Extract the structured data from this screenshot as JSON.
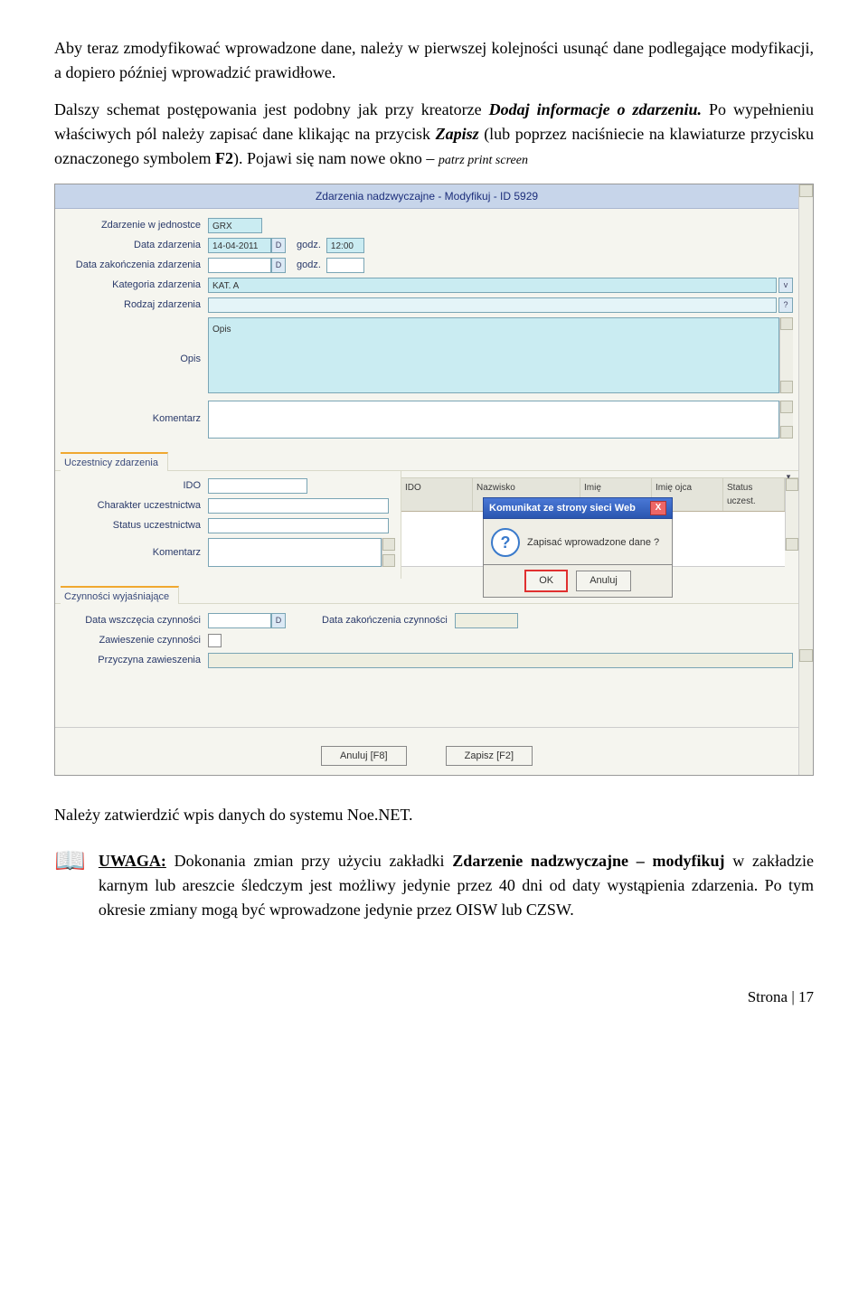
{
  "paragraph1": {
    "plain1": "Aby teraz zmodyfikować wprowadzone dane, należy w pierwszej kolejności usunąć dane podlegające modyfikacji, a dopiero później wprowadzić prawidłowe."
  },
  "paragraph2": {
    "lead": "Dalszy schemat postępowania jest podobny jak przy kreatorze ",
    "em1": "Dodaj informacje o zdarzeniu.",
    "cont1": " Po wypełnieniu właściwych pól należy zapisać dane klikając na przycisk ",
    "em2": "Zapisz",
    "cont2": " (lub poprzez naciśniecie na klawiaturze przycisku oznaczonego symbolem ",
    "f2": "F2",
    "cont3": "). Pojawi się nam nowe okno – ",
    "em3": "patrz print screen"
  },
  "screenshot": {
    "title": "Zdarzenia nadzwyczajne - Modyfikuj - ID 5929",
    "labels": {
      "jednostka": "Zdarzenie w jednostce",
      "data_zd": "Data zdarzenia",
      "godz": "godz.",
      "data_zak_zd": "Data zakończenia zdarzenia",
      "kategoria": "Kategoria zdarzenia",
      "rodzaj": "Rodzaj zdarzenia",
      "opis": "Opis",
      "komentarz": "Komentarz",
      "uczestnicy": "Uczestnicy zdarzenia",
      "ido": "IDO",
      "charakter": "Charakter uczestnictwa",
      "status_u": "Status uczestnictwa",
      "koment2": "Komentarz",
      "czynnosci": "Czynności wyjaśniające",
      "data_wszczecia": "Data wszczęcia czynności",
      "data_zak_czyn": "Data zakończenia czynności",
      "zawieszenie": "Zawieszenie czynności",
      "przyczyna": "Przyczyna zawieszenia"
    },
    "values": {
      "grx": "GRX",
      "data_zd": "14-04-2011",
      "godz": "12:00",
      "opis_content": "Opis",
      "kat": "KAT. A"
    },
    "table_headers": [
      "IDO",
      "Nazwisko",
      "Imię",
      "Imię ojca",
      "Status uczest."
    ],
    "dialog": {
      "title": "Komunikat ze strony sieci Web",
      "text": "Zapisać wprowadzone dane ?",
      "ok": "OK",
      "anuluj": "Anuluj"
    },
    "bottom": {
      "anuluj": "Anuluj [F8]",
      "zapisz": "Zapisz [F2]"
    }
  },
  "after1": "Należy zatwierdzić wpis danych do systemu Noe.NET.",
  "uwaga": {
    "label": "UWAGA:",
    "text1": " Dokonania zmian przy użyciu zakładki ",
    "em1": "Zdarzenie nadzwyczajne – modyfikuj",
    "text2": " w zakładzie karnym lub areszcie śledczym jest możliwy jedynie przez 40 dni od daty wystąpienia zdarzenia. Po tym okresie zmiany mogą być wprowadzone jedynie przez OISW lub CZSW."
  },
  "footer": "Strona | 17"
}
